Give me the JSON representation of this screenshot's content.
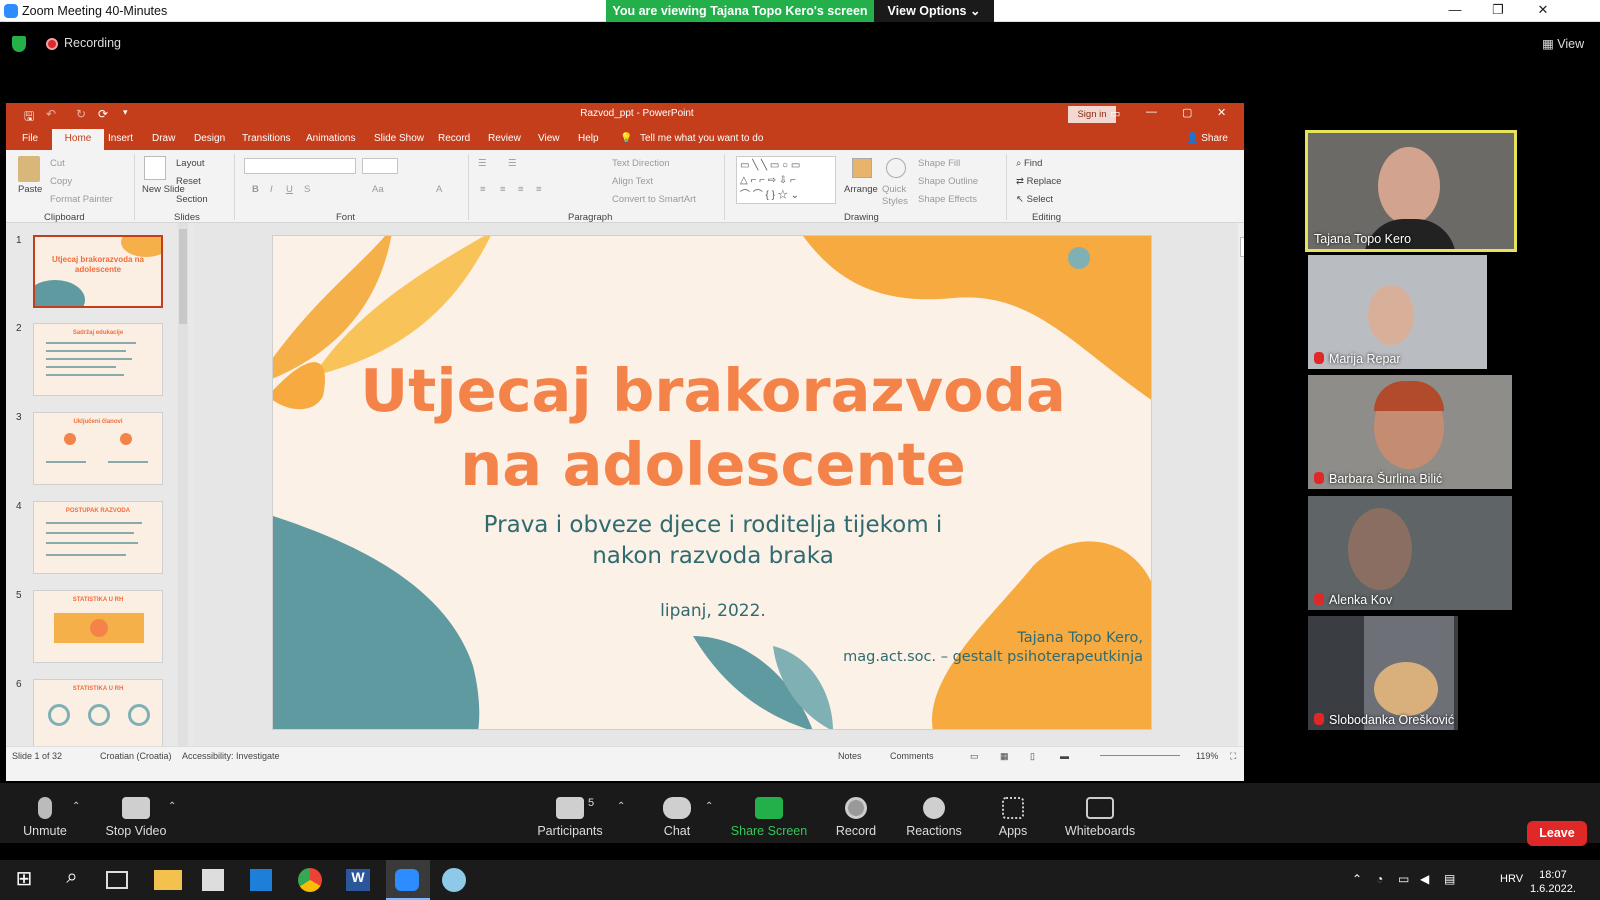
{
  "zoom": {
    "window_title": "Zoom Meeting 40-Minutes",
    "banner": "You are viewing Tajana Topo Kero's screen",
    "view_options": "View Options ⌄",
    "recording": "Recording",
    "view": "View"
  },
  "ppt": {
    "title": "Razvod_ppt  -  PowerPoint",
    "sign_in": "Sign in",
    "share": "Share",
    "tell_me": "Tell me what you want to do",
    "tabs": [
      "File",
      "Home",
      "Insert",
      "Draw",
      "Design",
      "Transitions",
      "Animations",
      "Slide Show",
      "Record",
      "Review",
      "View",
      "Help"
    ],
    "ribbon": {
      "clipboard": {
        "paste": "Paste",
        "cut": "Cut",
        "copy": "Copy",
        "format_painter": "Format Painter",
        "group": "Clipboard"
      },
      "slides": {
        "new_slide": "New Slide",
        "layout": "Layout",
        "reset": "Reset",
        "section": "Section",
        "group": "Slides"
      },
      "font": {
        "group": "Font"
      },
      "paragraph": {
        "text_direction": "Text Direction",
        "align_text": "Align Text",
        "convert": "Convert to SmartArt",
        "group": "Paragraph"
      },
      "drawing": {
        "arrange": "Arrange",
        "quick_styles": "Quick Styles",
        "shape_fill": "Shape Fill",
        "shape_outline": "Shape Outline",
        "shape_effects": "Shape Effects",
        "group": "Drawing"
      },
      "editing": {
        "find": "Find",
        "replace": "Replace",
        "select": "Select",
        "group": "Editing"
      }
    },
    "thumbnails": [
      {
        "num": "1",
        "title": "Utjecaj brakorazvoda na adolescente"
      },
      {
        "num": "2",
        "title": "Sadržaj edukacije"
      },
      {
        "num": "3",
        "title": "Uključeni članovi"
      },
      {
        "num": "4",
        "title": "POSTUPAK RAZVODA"
      },
      {
        "num": "5",
        "title": "STATISTIKA U RH"
      },
      {
        "num": "6",
        "title": "STATISTIKA U RH"
      }
    ],
    "slide": {
      "title_line1": "Utjecaj brakorazvoda",
      "title_line2": "na adolescente",
      "subtitle_line1": "Prava i obveze djece i roditelja tijekom i",
      "subtitle_line2": "nakon razvoda braka",
      "date": "lipanj, 2022.",
      "author_line1": "Tajana Topo Kero,",
      "author_line2": "mag.act.soc. – gestalt psihoterapeutkinja"
    },
    "status": {
      "slide_count": "Slide 1 of 32",
      "language": "Croatian (Croatia)",
      "accessibility": "Accessibility: Investigate",
      "notes": "Notes",
      "comments": "Comments",
      "zoom": "119%"
    }
  },
  "participants": [
    {
      "name": "Tajana Topo Kero",
      "active": true
    },
    {
      "name": "Marija Repar",
      "muted": true
    },
    {
      "name": "Barbara Šurlina Bilić",
      "muted": true
    },
    {
      "name": "Alenka Kov",
      "muted": true
    },
    {
      "name": "Slobodanka Orešković",
      "muted": true
    }
  ],
  "toolbar": {
    "unmute": "Unmute",
    "stop_video": "Stop Video",
    "participants": "Participants",
    "participants_count": "5",
    "chat": "Chat",
    "share_screen": "Share Screen",
    "record": "Record",
    "reactions": "Reactions",
    "apps": "Apps",
    "whiteboards": "Whiteboards",
    "leave": "Leave"
  },
  "taskbar": {
    "time": "18:07",
    "date": "1.6.2022.",
    "lang": "HRV"
  },
  "colors": {
    "ppt_red": "#c43e1c",
    "slide_orange": "#f4834a",
    "slide_teal": "#2f6b70",
    "zoom_green": "#23b04a",
    "leave_red": "#e02828"
  }
}
